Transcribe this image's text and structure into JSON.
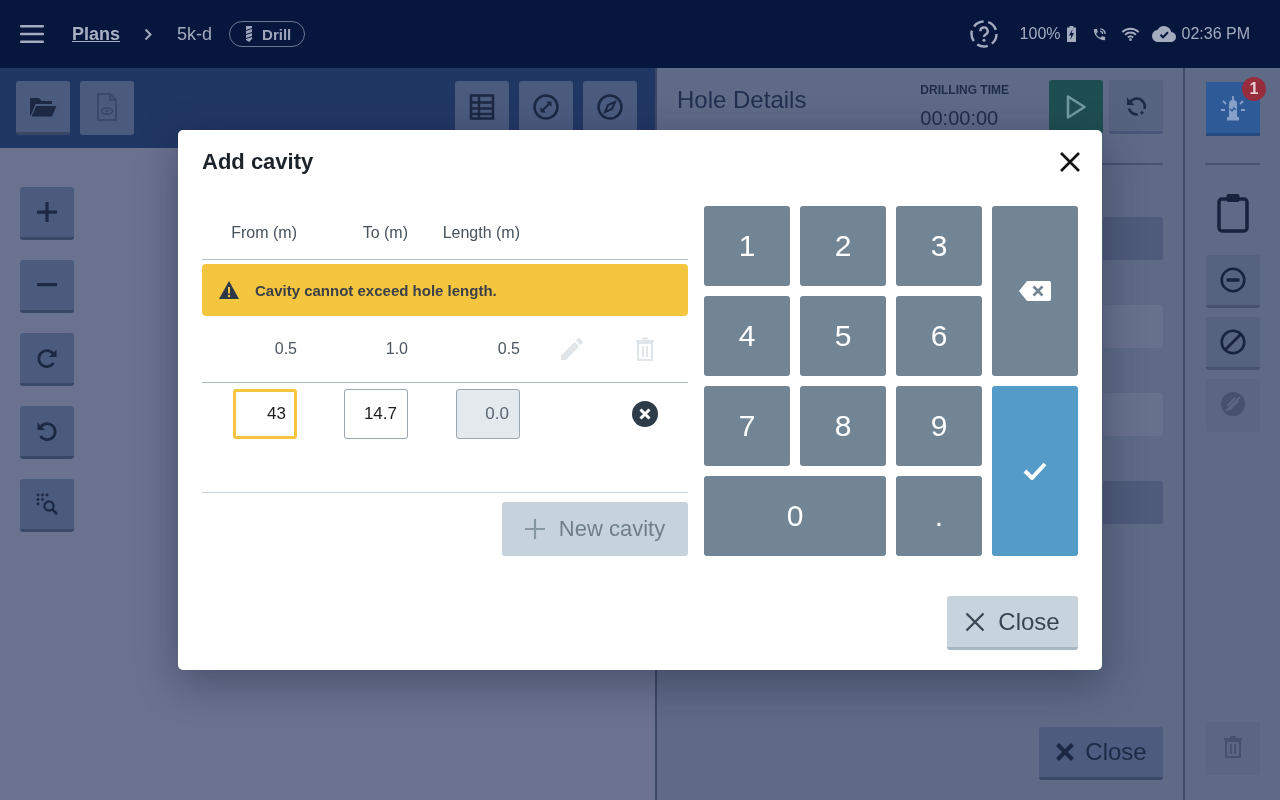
{
  "top_bar": {
    "breadcrumb": [
      {
        "label": "Plans",
        "kind": "link"
      },
      {
        "label": "5k-d",
        "kind": "current"
      }
    ],
    "tag": {
      "label": "Drill"
    },
    "status": {
      "battery": "100%",
      "time": "02:36 PM"
    }
  },
  "map_toolbar": {
    "buttons": [
      {
        "disabled": false
      },
      {
        "disabled": true
      },
      {
        "disabled": false
      },
      {
        "disabled": false
      },
      {
        "disabled": false
      }
    ]
  },
  "hole_details": {
    "title": "Hole Details",
    "drilling_time": {
      "label": "DRILLING TIME",
      "value": "00:00:00"
    },
    "close_button": {
      "label": "Close"
    }
  },
  "side_rail": {
    "alert_count": "1",
    "buttons": [
      {
        "disabled": false
      },
      {
        "disabled": false
      },
      {
        "disabled": true
      }
    ],
    "delete_button": {
      "disabled": true
    }
  },
  "dialog": {
    "title": "Add cavity",
    "columns": [
      "From (m)",
      "To (m)",
      "Length (m)"
    ],
    "warning": "Cavity cannot exceed hole length.",
    "rows": [
      {
        "from": "0.5",
        "to": "1.0",
        "length": "0.5",
        "edit_disabled": true,
        "delete_disabled": true
      }
    ],
    "new_row": {
      "fields": [
        {
          "value": "43",
          "focused": true,
          "disabled": false
        },
        {
          "value": "14.7",
          "focused": false,
          "disabled": false
        },
        {
          "value": "0.0",
          "focused": false,
          "disabled": true
        }
      ]
    },
    "new_cavity_button": {
      "label": "New cavity",
      "disabled": true
    },
    "keypad": [
      {
        "kind": "digit",
        "label": "1"
      },
      {
        "kind": "digit",
        "label": "2"
      },
      {
        "kind": "digit",
        "label": "3"
      },
      {
        "kind": "backspace"
      },
      {
        "kind": "digit",
        "label": "4"
      },
      {
        "kind": "digit",
        "label": "5"
      },
      {
        "kind": "digit",
        "label": "6"
      },
      {
        "kind": "digit",
        "label": "7"
      },
      {
        "kind": "digit",
        "label": "8"
      },
      {
        "kind": "digit",
        "label": "9"
      },
      {
        "kind": "confirm"
      },
      {
        "kind": "wide",
        "label": "0"
      },
      {
        "kind": "digit",
        "label": "."
      }
    ],
    "close_button": {
      "label": "Close"
    }
  }
}
